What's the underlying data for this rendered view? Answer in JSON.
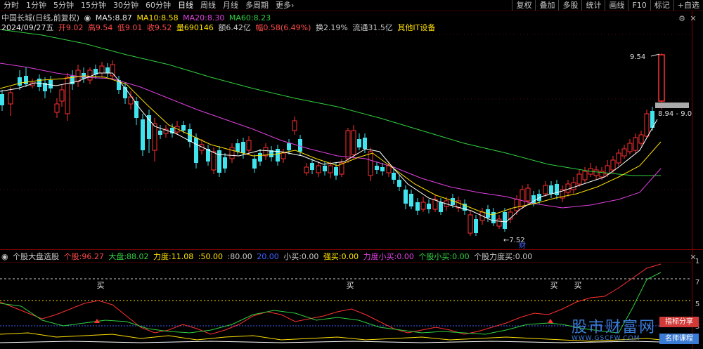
{
  "periods": [
    "分时",
    "1分钟",
    "5分钟",
    "15分钟",
    "30分钟",
    "60分钟",
    "日线",
    "周线",
    "月线",
    "多周期",
    "更多›"
  ],
  "active_period": "日线",
  "toolbar": [
    "复权",
    "叠加",
    "多股",
    "统计",
    "画线",
    "F10",
    "标记",
    "+自选"
  ],
  "stock": {
    "name_label": "中国长城(日线,前复权)",
    "ma": [
      {
        "label": "MA5:",
        "value": "8.87",
        "color": "#ffffff"
      },
      {
        "label": "MA10:",
        "value": "8.58",
        "color": "#ffe000"
      },
      {
        "label": "MA20:",
        "value": "8.30",
        "color": "#e040e0"
      },
      {
        "label": "MA60:",
        "value": "8.23",
        "color": "#30d040"
      }
    ],
    "date": "2024/09/27五",
    "open_label": "开",
    "open": "9.02",
    "high_label": "高",
    "high": "9.54",
    "low_label": "低",
    "low": "9.01",
    "close_label": "收",
    "close": "9.52",
    "vol_label": "量",
    "vol": "690146",
    "amount_label": "额",
    "amount": "6.42亿",
    "change_label": "幅",
    "change": "0.58(6.49%)",
    "turnover_label": "换",
    "turnover": "2.19%",
    "float_label": "流通",
    "float": "31.5亿",
    "sector": "其他IT设备"
  },
  "price_labels": {
    "high": "9.54",
    "low": "7.52",
    "range": "8.94 - 9.0"
  },
  "event_marker": "财",
  "indicator": {
    "name": "个股大盘选股",
    "items": [
      {
        "label": "个股:",
        "value": "96.27",
        "color": "#ff4a4a"
      },
      {
        "label": "大盘:",
        "value": "88.02",
        "color": "#30d040"
      },
      {
        "label": "力度:",
        "value": "11.08",
        "color": "#ffe000"
      },
      {
        "label": ":",
        "value": "50.00",
        "color": "#ffe000"
      },
      {
        "label": ":",
        "value": "80.00",
        "color": "#c8c8c8"
      },
      {
        "label": "",
        "value": "20.00",
        "color": "#4060ff"
      },
      {
        "label": "小买:",
        "value": "0.00",
        "color": "#c8c8c8"
      },
      {
        "label": "强买:",
        "value": "0.00",
        "color": "#ffe000"
      },
      {
        "label": "力度小买:",
        "value": "0.00",
        "color": "#e040e0"
      },
      {
        "label": "个股小买:",
        "value": "0.00",
        "color": "#30d040"
      },
      {
        "label": "个股力度买:",
        "value": "0.00",
        "color": "#c8c8c8"
      }
    ],
    "buy_label": "买",
    "scale": [
      "1",
      "7",
      "5",
      "3"
    ]
  },
  "watermark": {
    "title": "股市财富网",
    "url": "WWW.GSCFW.COM",
    "tag1": "指标分享",
    "tag2": "名师课程"
  },
  "colors": {
    "up": "#ff3030",
    "down": "#3fe4ee",
    "ma5": "#ffffff",
    "ma10": "#ffe000",
    "ma20": "#e040e0",
    "ma60": "#30d040"
  }
}
